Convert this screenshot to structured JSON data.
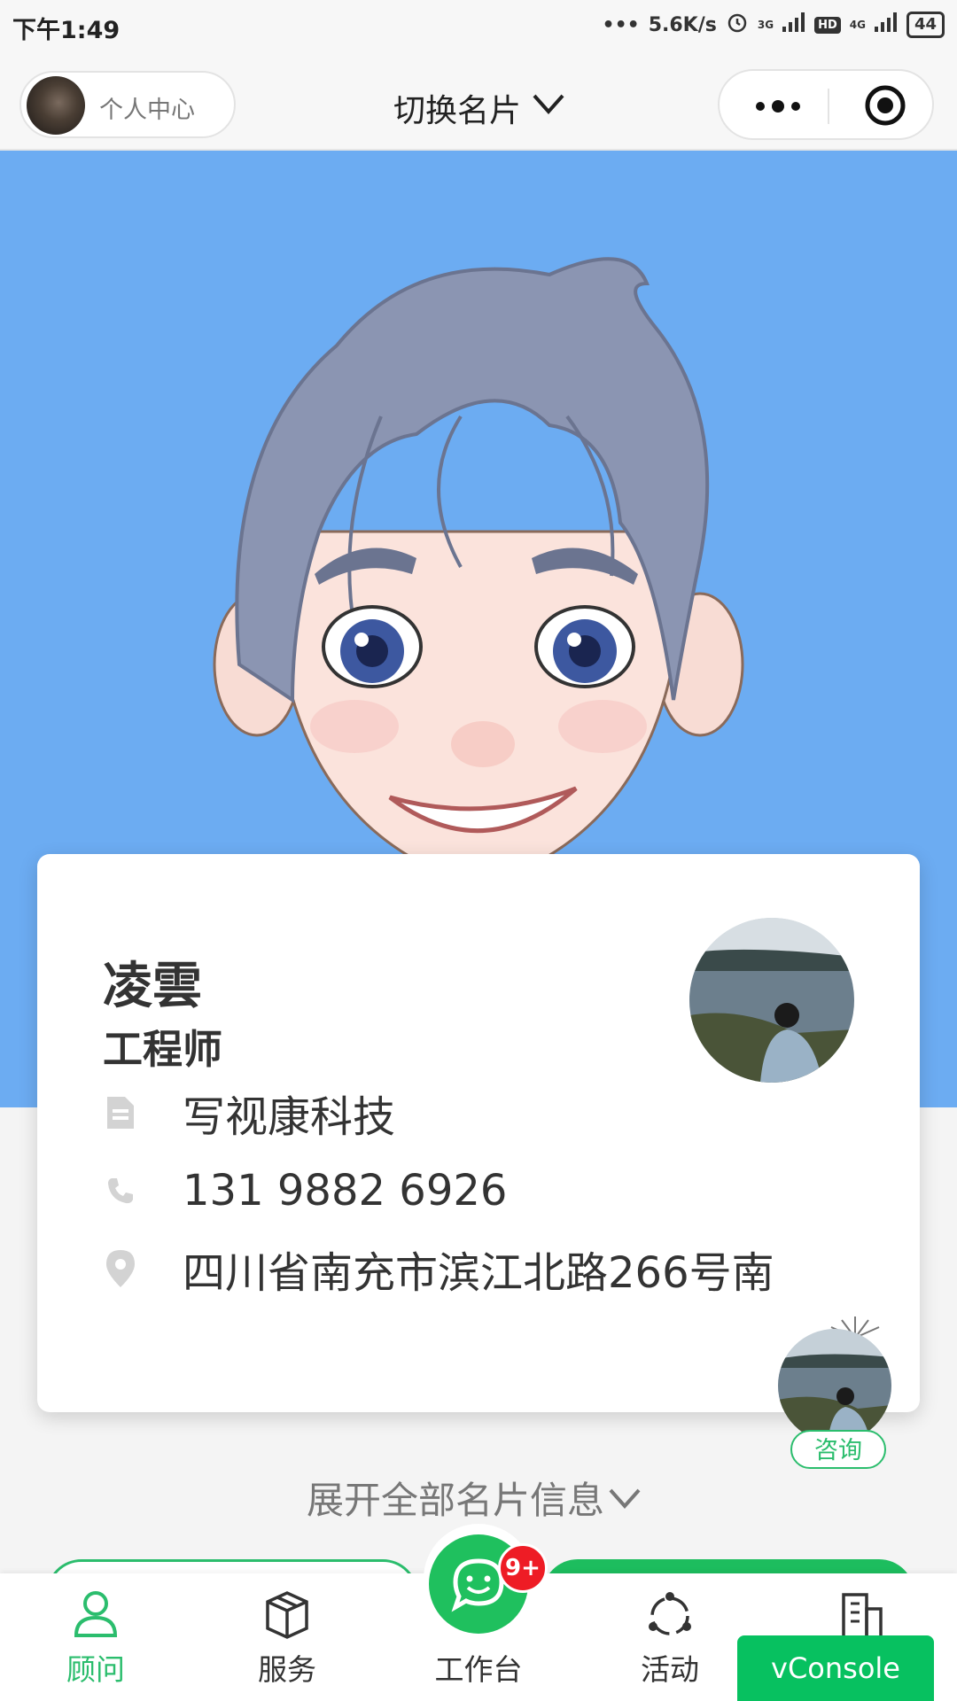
{
  "status_bar": {
    "time": "下午1:49",
    "speed": "5.6K/s",
    "net1": "3G",
    "hd": "HD",
    "net2": "4G",
    "battery": "44"
  },
  "nav": {
    "profile_label": "个人中心",
    "title": "切换名片"
  },
  "card": {
    "name": "凌雲",
    "job_title": "工程师",
    "company": "写视康科技",
    "phone": "131 9882 6926",
    "address": "四川省南充市滨江北路266号南"
  },
  "consult_label": "咨询",
  "expand_label": "展开全部名片信息",
  "tabbar": {
    "tabs": [
      {
        "label": "顾问",
        "icon": "person-icon"
      },
      {
        "label": "服务",
        "icon": "box-icon"
      },
      {
        "label": "工作台",
        "icon": "chat-icon"
      },
      {
        "label": "活动",
        "icon": "activity-icon"
      },
      {
        "label": "",
        "icon": "building-icon"
      }
    ],
    "badge": "9+"
  },
  "vconsole_label": "vConsole",
  "colors": {
    "accent": "#2bbd6d",
    "hero_bg": "#6cacf2",
    "badge": "#ee1c25"
  }
}
